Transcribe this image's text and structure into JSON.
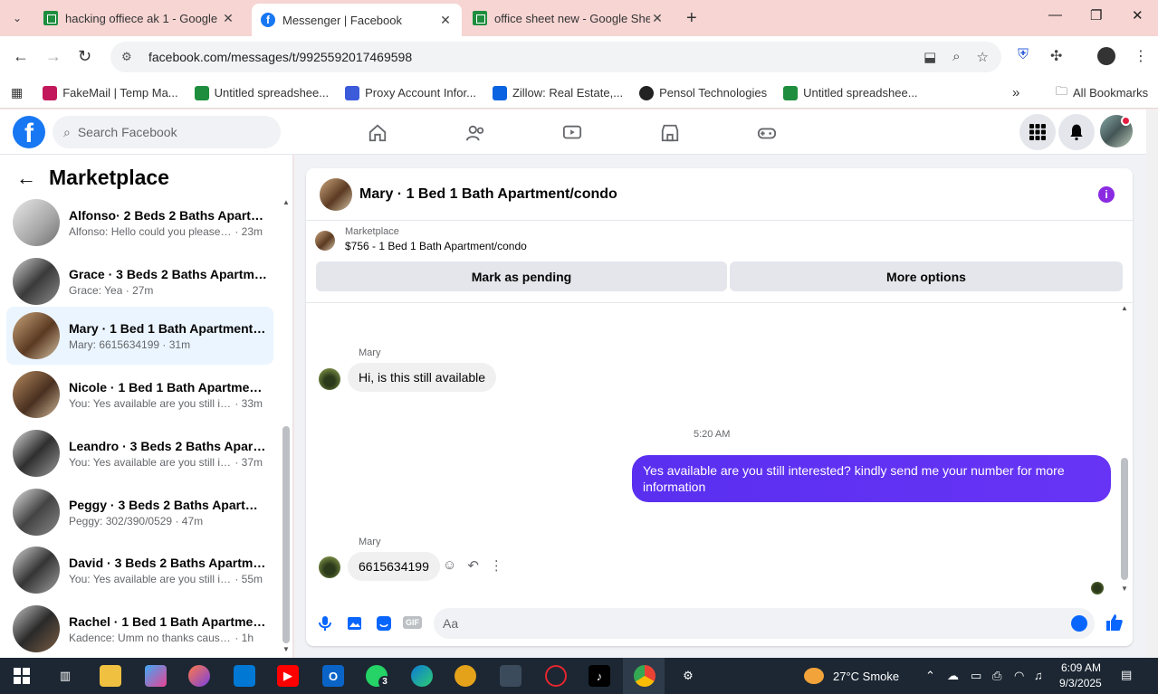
{
  "browser": {
    "tabs": [
      {
        "title": "hacking offiece ak 1 - Google Sl",
        "icon": "sheets-icon"
      },
      {
        "title": "Messenger | Facebook",
        "icon": "facebook-icon",
        "active": true
      },
      {
        "title": "office sheet new - Google Shee",
        "icon": "sheets-icon"
      }
    ],
    "url": "facebook.com/messages/t/9925592017469598",
    "bookmarks": [
      {
        "label": "FakeMail | Temp Ma..."
      },
      {
        "label": "Untitled spreadshee..."
      },
      {
        "label": "Proxy Account Infor..."
      },
      {
        "label": "Zillow: Real Estate,..."
      },
      {
        "label": "Pensol Technologies"
      },
      {
        "label": "Untitled spreadshee..."
      }
    ],
    "all_bookmarks": "All Bookmarks",
    "overflow": "»"
  },
  "fb": {
    "logo": "f",
    "search_placeholder": "Search Facebook"
  },
  "sidebar": {
    "title": "Marketplace",
    "conversations": [
      {
        "name": "Alfonso· 2 Beds 2 Baths Apartment...",
        "preview": "Alfonso: Hello could you please ...",
        "time": "23m"
      },
      {
        "name": "Grace · 3 Beds 2 Baths Apartment...",
        "preview": "Grace: Yea",
        "time": "27m"
      },
      {
        "name": "Mary · 1 Bed 1 Bath Apartment/condo",
        "preview": "Mary: 6615634199",
        "time": "31m",
        "selected": true
      },
      {
        "name": "Nicole · 1 Bed 1 Bath Apartment...",
        "preview": "You: Yes available are you still int...",
        "time": "33m"
      },
      {
        "name": "Leandro · 3 Beds 2 Baths Apartment...",
        "preview": "You: Yes available are you still int...",
        "time": "37m"
      },
      {
        "name": "Peggy · 3 Beds 2 Baths Apartment...",
        "preview": "Peggy: 302/390/0529",
        "time": "47m"
      },
      {
        "name": "David · 3 Beds 2 Baths Apartment...",
        "preview": "You: Yes available are you still int...",
        "time": "55m"
      },
      {
        "name": "Rachel · 1 Bed 1 Bath Apartment...",
        "preview": "Kadence: Umm no thanks cause if ...",
        "time": "1h"
      }
    ]
  },
  "chat": {
    "title": "Mary · 1 Bed 1 Bath Apartment/condo",
    "listing_source": "Marketplace",
    "listing_title": "$756 - 1 Bed 1 Bath Apartment/condo",
    "mark_pending": "Mark as pending",
    "more_options": "More options",
    "messages": {
      "sender1": "Mary",
      "msg1": "Hi, is this still available",
      "time_sep": "5:20 AM",
      "msg2": "Yes available are you still interested? kindly send me your number for more information",
      "sender3": "Mary",
      "msg3": "6615634199"
    },
    "input_placeholder": "Aa",
    "gif_label": "GIF"
  },
  "taskbar": {
    "weather": "27°C  Smoke",
    "time": "6:09 AM",
    "date": "9/3/2025",
    "whatsapp_badge": "3"
  },
  "colors": {
    "fb_blue": "#1877f2",
    "outgoing_bubble": "#5b2ff2",
    "selected_row": "#ebf5ff"
  }
}
